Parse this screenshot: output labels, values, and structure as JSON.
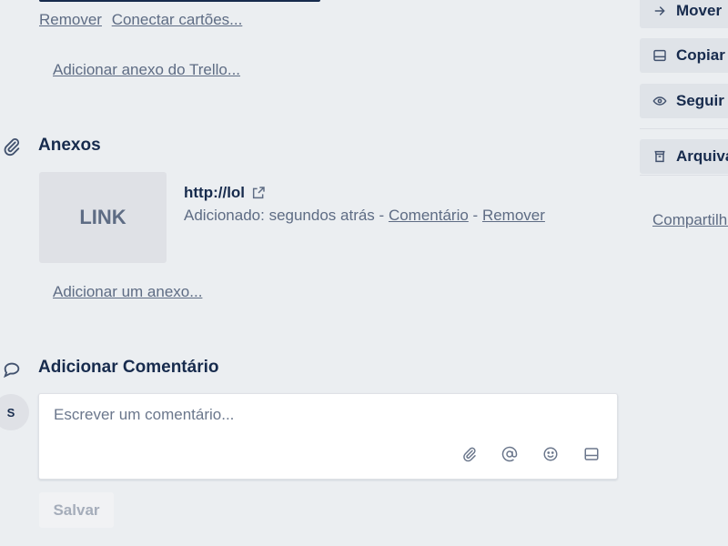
{
  "checklist_links": {
    "remove": "Remover",
    "connect": "Conectar cartões..."
  },
  "trello_attachment": "Adicionar anexo do Trello...",
  "attachments": {
    "title": "Anexos",
    "thumb_label": "LINK",
    "item": {
      "name": "http://lol",
      "added_prefix": "Adicionado: segundos atrás -",
      "comment": "Comentário",
      "separator": "-",
      "remove": "Remover"
    },
    "add": "Adicionar um anexo..."
  },
  "comment": {
    "title": "Adicionar Comentário",
    "avatar": "S",
    "placeholder": "Escrever um comentário...",
    "save": "Salvar"
  },
  "sidebar": {
    "move": "Mover",
    "copy": "Copiar",
    "watch": "Seguir",
    "archive": "Arquivar",
    "share": "Compartilhar"
  }
}
